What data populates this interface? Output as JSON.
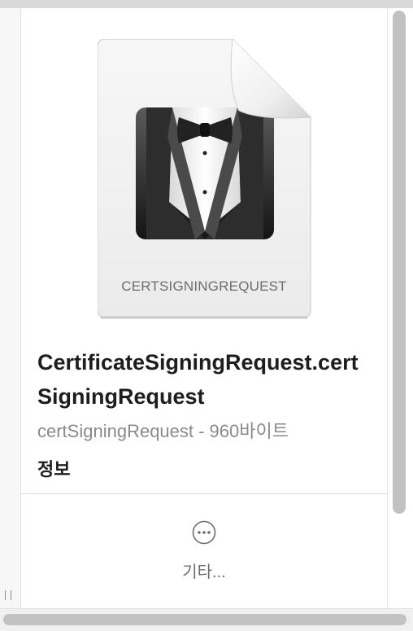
{
  "preview": {
    "doc_type_label": "CERTSIGNINGREQUEST",
    "icon": "certificate-assistant-butler-icon"
  },
  "file": {
    "name": "CertificateSigningRequest.certSigningRequest",
    "meta": "certSigningRequest - 960바이트"
  },
  "info_section": {
    "heading": "정보"
  },
  "actions": {
    "more_label": "기타...",
    "more_icon": "ellipsis-circle-icon"
  },
  "colors": {
    "panel_bg": "#ffffff",
    "scrollbar_thumb": "#c1c1c1",
    "primary_text": "#1d1d1d",
    "secondary_text": "#8a8a8a"
  }
}
